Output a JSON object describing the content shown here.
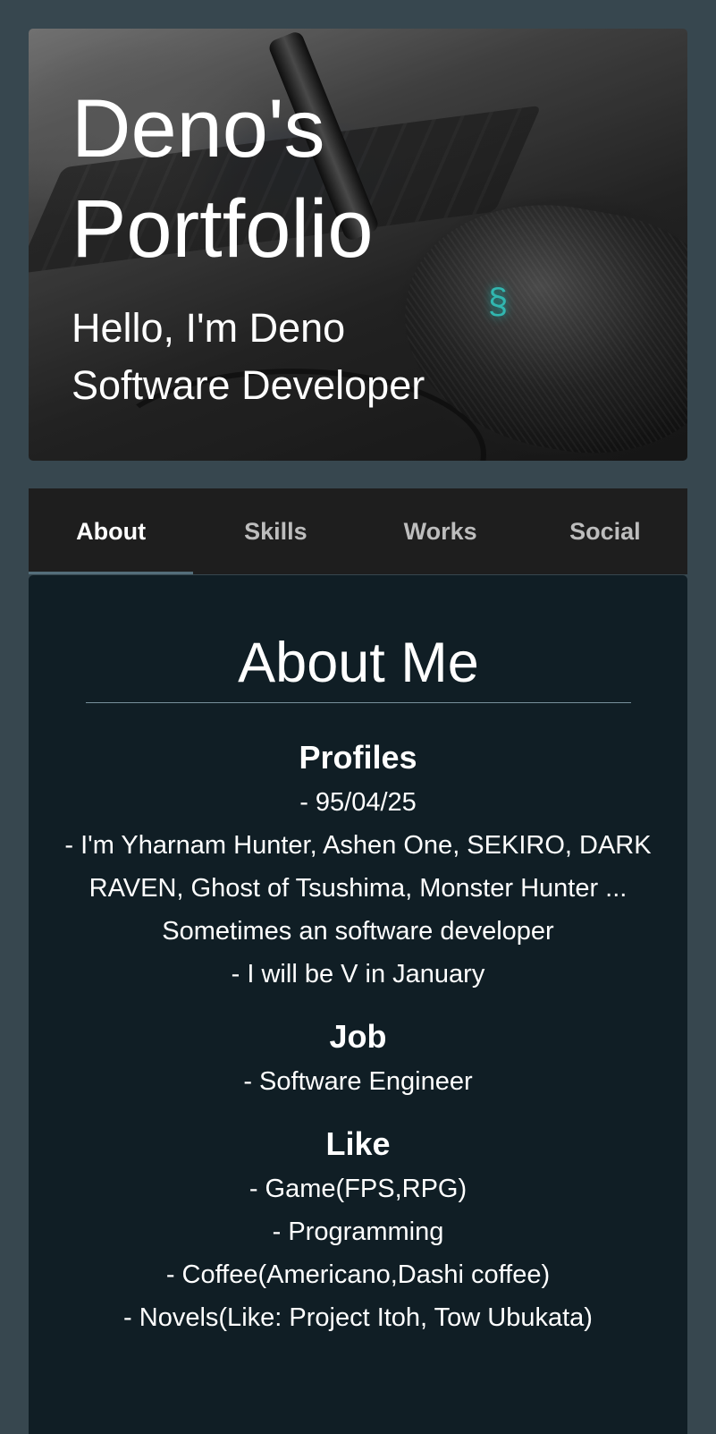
{
  "hero": {
    "title": "Deno's Portfolio",
    "greeting": "Hello, I'm Deno",
    "role": "Software Developer"
  },
  "tabs": [
    {
      "label": "About",
      "active": true
    },
    {
      "label": "Skills",
      "active": false
    },
    {
      "label": "Works",
      "active": false
    },
    {
      "label": "Social",
      "active": false
    }
  ],
  "about": {
    "heading": "About Me",
    "sections": [
      {
        "title": "Profiles",
        "lines": [
          "- 95/04/25",
          "- I'm Yharnam Hunter, Ashen One, SEKIRO, DARK RAVEN, Ghost of Tsushima, Monster Hunter ... Sometimes an software developer",
          "- I will be V in January"
        ]
      },
      {
        "title": "Job",
        "lines": [
          "- Software Engineer"
        ]
      },
      {
        "title": "Like",
        "lines": [
          "- Game(FPS,RPG)",
          "- Programming",
          "- Coffee(Americano,Dashi coffee)",
          "- Novels(Like: Project Itoh, Tow Ubukata)"
        ]
      }
    ]
  },
  "colors": {
    "page_bg": "#37474f",
    "tab_bar_bg": "#1e1e1e",
    "content_bg": "#101e25",
    "tab_indicator": "#546e7a"
  }
}
